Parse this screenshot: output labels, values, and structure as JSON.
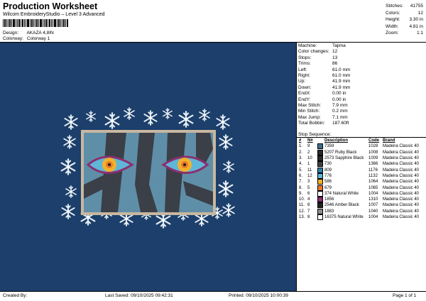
{
  "header": {
    "title": "Production Worksheet",
    "subtitle": "Wilcom EmbroideryStudio – Level 3 Advanced",
    "design_label": "Design:",
    "design_value": "AKAZA 4,8IN",
    "colorway_label": "Colorway:",
    "colorway_value": "Colorway 1"
  },
  "summary": {
    "stitches_label": "Stitches:",
    "stitches": "41755",
    "colors_label": "Colors:",
    "colors": "12",
    "height_label": "Height:",
    "height": "3.30 in",
    "width_label": "Width:",
    "width": "4.81 in",
    "zoom_label": "Zoom:",
    "zoom": "1:1"
  },
  "specs": [
    {
      "label": "Machine:",
      "value": "Tajima"
    },
    {
      "label": "Color changes:",
      "value": "12"
    },
    {
      "label": "Stops:",
      "value": "13"
    },
    {
      "label": "Trims:",
      "value": "86"
    },
    {
      "label": "Left:",
      "value": "61.0 mm"
    },
    {
      "label": "Right:",
      "value": "61.0 mm"
    },
    {
      "label": "Up:",
      "value": "41.9 mm"
    },
    {
      "label": "Down:",
      "value": "41.9 mm"
    },
    {
      "label": "EndX:",
      "value": "0.00 in"
    },
    {
      "label": "EndY:",
      "value": "0.00 in"
    },
    {
      "label": "Max Stitch:",
      "value": "7.9 mm"
    },
    {
      "label": "Min Stitch:",
      "value": "0.2 mm"
    },
    {
      "label": "Max Jump:",
      "value": "7.1 mm"
    },
    {
      "label": "Total Bobbin:",
      "value": "187.60ft"
    }
  ],
  "stop_sequence": {
    "title": "Stop Sequence:",
    "headers": [
      "#",
      "N#",
      "",
      "Description",
      "Code",
      "Brand"
    ],
    "rows": [
      {
        "n": "1.",
        "nn": "9",
        "color": "#3c6e8c",
        "desc": "7359",
        "code": "1028",
        "brand": "Madeira Classic 40"
      },
      {
        "n": "2.",
        "nn": "2",
        "color": "#2a2a2a",
        "desc": "5207  Ruby Black",
        "code": "1008",
        "brand": "Madeira Classic 40"
      },
      {
        "n": "3.",
        "nn": "10",
        "color": "#2b2b2b",
        "desc": "2573  Sapphire Black",
        "code": "1009",
        "brand": "Madeira Classic 40"
      },
      {
        "n": "4.",
        "nn": "1",
        "color": "#3b3f47",
        "desc": "730",
        "code": "1366",
        "brand": "Madeira Classic 40"
      },
      {
        "n": "5.",
        "nn": "11",
        "color": "#2e7fa6",
        "desc": "809",
        "code": "1176",
        "brand": "Madeira Classic 40"
      },
      {
        "n": "6.",
        "nn": "12",
        "color": "#5fb6d8",
        "desc": "776",
        "code": "1132",
        "brand": "Madeira Classic 40"
      },
      {
        "n": "7.",
        "nn": "3",
        "color": "#f3b12a",
        "desc": "586",
        "code": "1064",
        "brand": "Madeira Classic 40"
      },
      {
        "n": "8.",
        "nn": "5",
        "color": "#e8782a",
        "desc": "679",
        "code": "1065",
        "brand": "Madeira Classic 40"
      },
      {
        "n": "9.",
        "nn": "6",
        "color": "#ffffff",
        "desc": "374  Natural White",
        "code": "1004",
        "brand": "Madeira Classic 40"
      },
      {
        "n": "10.",
        "nn": "4",
        "color": "#8b2f6f",
        "desc": "1856",
        "code": "1310",
        "brand": "Madeira Classic 40"
      },
      {
        "n": "11.",
        "nn": "8",
        "color": "#222222",
        "desc": "2546  Amber Black",
        "code": "1007",
        "brand": "Madeira Classic 40"
      },
      {
        "n": "12.",
        "nn": "7",
        "color": "#8c8c8c",
        "desc": "1883",
        "code": "1040",
        "brand": "Madeira Classic 40"
      },
      {
        "n": "13.",
        "nn": "8",
        "color": "#ffffff",
        "desc": "16375  Natural White",
        "code": "1004",
        "brand": "Madeira Classic 40"
      }
    ]
  },
  "footer": {
    "created_by": "Created By:",
    "last_saved": "Last Saved: 09/10/2025 09:42:31",
    "printed": "Printed: 09/10/2025 10:00:39",
    "page": "Page 1 of 1"
  },
  "colors": {
    "background": "#1c3f6b",
    "frame": "#c8b7a0",
    "panel": "#5f8fa8"
  }
}
